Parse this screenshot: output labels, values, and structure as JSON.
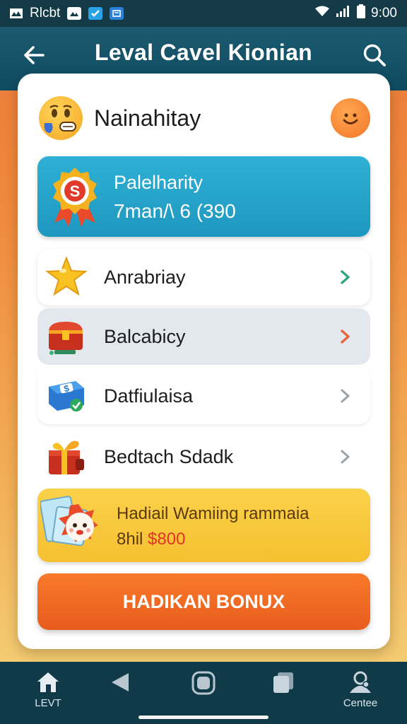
{
  "status_bar": {
    "carrier": "Rlcbt",
    "time": "9:00"
  },
  "header": {
    "title": "Leval Cavel Kionian"
  },
  "profile": {
    "name": "Nainahitay"
  },
  "balance": {
    "label": "Palelharity",
    "value": "7man/\\ 6 (390"
  },
  "menu": {
    "items": [
      {
        "label": "Anrabriay",
        "icon": "star-icon",
        "chevron_color": "#2eaa7c"
      },
      {
        "label": "Balcabicy",
        "icon": "treasure-chest-icon",
        "chevron_color": "#e8643a"
      },
      {
        "label": "Datfiulaisa",
        "icon": "cash-icon",
        "chevron_color": "#9aa3a9"
      },
      {
        "label": "Bedtach Sdadk",
        "icon": "gift-icon",
        "chevron_color": "#9aa3a9"
      }
    ]
  },
  "promo": {
    "title": "Hadiail Wamiing rammaia",
    "prefix": "8hil",
    "amount": "$800"
  },
  "cta": {
    "label": "HADIKAN BONUX"
  },
  "bottom_nav": {
    "items": [
      {
        "label": "LEVT",
        "icon": "home-icon"
      },
      {
        "label": "",
        "icon": "back-triangle-icon"
      },
      {
        "label": "",
        "icon": "square-home-icon"
      },
      {
        "label": "",
        "icon": "cards-icon"
      },
      {
        "label": "Centee",
        "icon": "profile-icon"
      }
    ]
  },
  "colors": {
    "header_bg": "#0f4b60",
    "accent_orange": "#f2762a",
    "banner_blue": "#1e97bf",
    "promo_yellow": "#f5c030",
    "promo_amount": "#e0342a"
  }
}
